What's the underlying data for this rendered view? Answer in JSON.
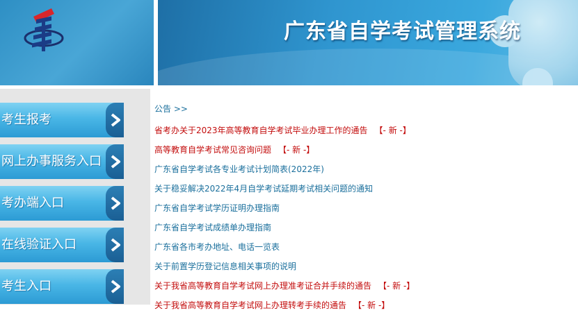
{
  "header": {
    "title": "广东省自学考试管理系统"
  },
  "sidebar": {
    "items": [
      {
        "label": "考生报考"
      },
      {
        "label": "网上办事服务入口"
      },
      {
        "label": "考办端入口"
      },
      {
        "label": "在线验证入口"
      },
      {
        "label": "考生入口"
      }
    ]
  },
  "notices": {
    "section_title": "公告 >>",
    "new_tag": "【- 新 -】",
    "items": [
      {
        "text": "省考办关于2023年高等教育自学考试毕业办理工作的通告",
        "color": "red",
        "new": true
      },
      {
        "text": "高等教育自学考试常见咨询问题",
        "color": "red",
        "new": true
      },
      {
        "text": "广东省自学考试各专业考试计划简表(2022年)",
        "color": "blue",
        "new": false
      },
      {
        "text": "关于稳妥解决2022年4月自学考试延期考试相关问题的通知",
        "color": "blue",
        "new": false
      },
      {
        "text": "广东省自学考试学历证明办理指南",
        "color": "blue",
        "new": false
      },
      {
        "text": "广东省自学考试成绩单办理指南",
        "color": "blue",
        "new": false
      },
      {
        "text": "广东省各市考办地址、电话一览表",
        "color": "blue",
        "new": false
      },
      {
        "text": "关于前置学历登记信息相关事项的说明",
        "color": "blue",
        "new": false
      },
      {
        "text": "关于我省高等教育自学考试网上办理准考证合并手续的通告",
        "color": "red",
        "new": true
      },
      {
        "text": "关于我省高等教育自学考试网上办理转考手续的通告",
        "color": "red",
        "new": true
      }
    ]
  },
  "colors": {
    "link_blue": "#1a6f9c",
    "link_red": "#c30d0d",
    "nav_blue": "#49b6e6"
  }
}
